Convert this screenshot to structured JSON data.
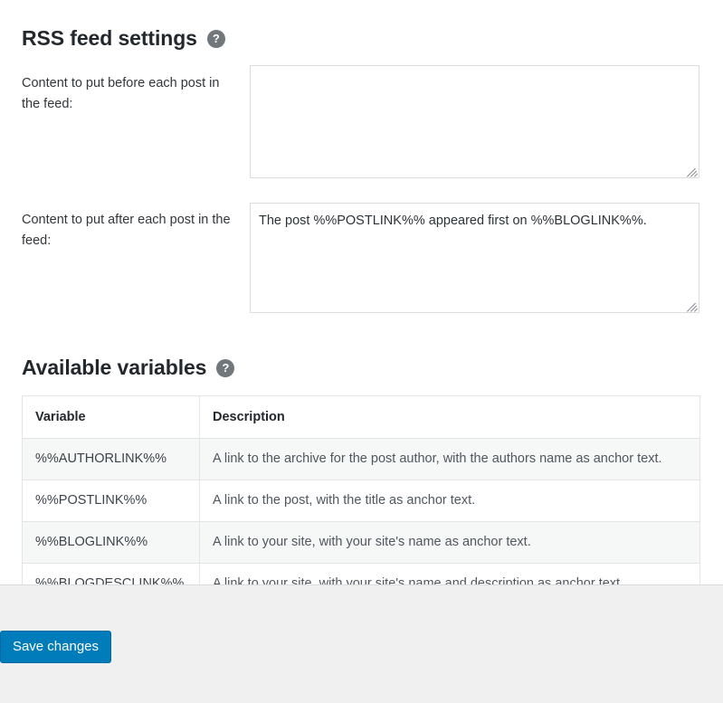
{
  "sections": {
    "rss": {
      "title": "RSS feed settings",
      "help_icon": "question-mark-icon",
      "fields": {
        "before": {
          "label": "Content to put before each post in the feed:",
          "value": "",
          "placeholder": ""
        },
        "after": {
          "label": "Content to put after each post in the feed:",
          "value": "The post %%POSTLINK%% appeared first on %%BLOGLINK%%.",
          "placeholder": ""
        }
      }
    },
    "variables": {
      "title": "Available variables",
      "help_icon": "question-mark-icon",
      "table": {
        "headers": {
          "variable": "Variable",
          "description": "Description"
        },
        "rows": [
          {
            "variable": "%%AUTHORLINK%%",
            "description": "A link to the archive for the post author, with the authors name as anchor text."
          },
          {
            "variable": "%%POSTLINK%%",
            "description": "A link to the post, with the title as anchor text."
          },
          {
            "variable": "%%BLOGLINK%%",
            "description": "A link to your site, with your site's name as anchor text."
          },
          {
            "variable": "%%BLOGDESCLINK%%",
            "description": "A link to your site, with your site's name and description as anchor text."
          }
        ]
      }
    }
  },
  "footer": {
    "save_label": "Save changes"
  },
  "colors": {
    "accent": "#007cba",
    "heading": "#23282d",
    "body_text": "#50575e",
    "border": "#e2e4e7",
    "row_alt": "#f6f7f7",
    "footer_bg": "#f0f0f1",
    "help_icon_bg": "#72777c"
  }
}
